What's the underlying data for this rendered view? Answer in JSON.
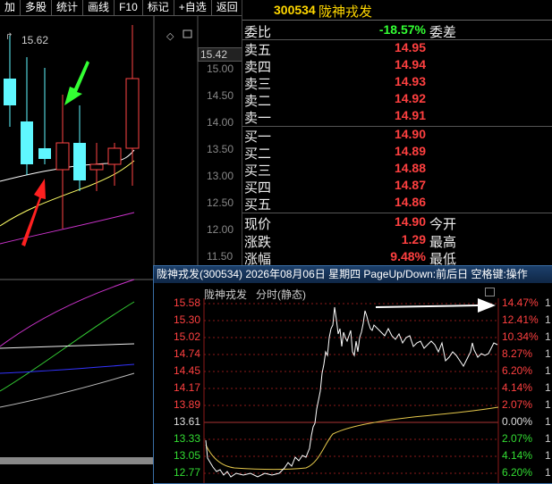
{
  "menu": [
    "加",
    "多股",
    "统计",
    "画线",
    "F10",
    "标记",
    "+自选",
    "返回"
  ],
  "kchart": {
    "top_label": "15.62",
    "price_tag": "15.42",
    "y_labels": [
      "15.00",
      "14.50",
      "14.00",
      "13.50",
      "13.00",
      "12.50",
      "12.00",
      "11.50"
    ],
    "candles": [
      {
        "o": 14.3,
        "h": 15.6,
        "l": 13.9,
        "c": 14.8,
        "color": "cyan"
      },
      {
        "o": 14.0,
        "h": 15.2,
        "l": 13.0,
        "c": 13.2,
        "color": "cyan"
      },
      {
        "o": 13.5,
        "h": 15.0,
        "l": 13.2,
        "c": 13.3,
        "color": "cyan"
      },
      {
        "o": 13.1,
        "h": 14.5,
        "l": 12.0,
        "c": 13.6,
        "color": "red"
      },
      {
        "o": 13.6,
        "h": 14.3,
        "l": 12.7,
        "c": 12.9,
        "color": "cyan"
      },
      {
        "o": 13.1,
        "h": 13.6,
        "l": 12.7,
        "c": 13.2,
        "color": "red"
      },
      {
        "o": 13.2,
        "h": 13.6,
        "l": 12.8,
        "c": 13.5,
        "color": "red"
      },
      {
        "o": 13.5,
        "h": 15.8,
        "l": 12.8,
        "c": 14.8,
        "color": "red"
      }
    ],
    "arrows": [
      {
        "color": "#ff2020"
      },
      {
        "color": "#33ff33"
      }
    ]
  },
  "quote": {
    "code": "300534",
    "name": "陇神戎发",
    "ratio_label": "委比",
    "ratio_value": "-18.57%",
    "ratio_extra": "委差",
    "asks": [
      {
        "label": "卖五",
        "price": "14.95"
      },
      {
        "label": "卖四",
        "price": "14.94"
      },
      {
        "label": "卖三",
        "price": "14.93"
      },
      {
        "label": "卖二",
        "price": "14.92"
      },
      {
        "label": "卖一",
        "price": "14.91"
      }
    ],
    "bids": [
      {
        "label": "买一",
        "price": "14.90"
      },
      {
        "label": "买二",
        "price": "14.89"
      },
      {
        "label": "买三",
        "price": "14.88"
      },
      {
        "label": "买四",
        "price": "14.87"
      },
      {
        "label": "买五",
        "price": "14.86"
      }
    ],
    "stats": [
      {
        "label": "现价",
        "value": "14.90",
        "extra": "今开"
      },
      {
        "label": "涨跌",
        "value": "1.29",
        "extra": "最高"
      },
      {
        "label": "涨幅",
        "value": "9.48%",
        "extra": "最低"
      }
    ]
  },
  "popup": {
    "title": "陇神戎发(300534) 2026年08月06日 星期四 PageUp/Down:前后日 空格键:操作",
    "subtitle": "陇神戎发",
    "mode": "分时(静态)",
    "left_prices": [
      {
        "v": "15.58",
        "c": "#ff4040"
      },
      {
        "v": "15.30",
        "c": "#ff4040"
      },
      {
        "v": "15.02",
        "c": "#ff4040"
      },
      {
        "v": "14.74",
        "c": "#ff4040"
      },
      {
        "v": "14.45",
        "c": "#ff4040"
      },
      {
        "v": "14.17",
        "c": "#ff4040"
      },
      {
        "v": "13.89",
        "c": "#ff4040"
      },
      {
        "v": "13.61",
        "c": "#dddddd"
      },
      {
        "v": "13.33",
        "c": "#33dd33"
      },
      {
        "v": "13.05",
        "c": "#33dd33"
      },
      {
        "v": "12.77",
        "c": "#33dd33"
      }
    ],
    "right_pcts": [
      {
        "v": "14.47%",
        "c": "#ff4040"
      },
      {
        "v": "12.41%",
        "c": "#ff4040"
      },
      {
        "v": "10.34%",
        "c": "#ff4040"
      },
      {
        "v": "8.27%",
        "c": "#ff4040"
      },
      {
        "v": "6.20%",
        "c": "#ff4040"
      },
      {
        "v": "4.14%",
        "c": "#ff4040"
      },
      {
        "v": "2.07%",
        "c": "#ff4040"
      },
      {
        "v": "0.00%",
        "c": "#dddddd"
      },
      {
        "v": "2.07%",
        "c": "#33dd33"
      },
      {
        "v": "4.14%",
        "c": "#33dd33"
      },
      {
        "v": "6.20%",
        "c": "#33dd33"
      }
    ],
    "edge": [
      "1",
      "1",
      "1",
      "1",
      "1",
      "1",
      "1",
      "1",
      "1",
      "1",
      "1"
    ]
  }
}
